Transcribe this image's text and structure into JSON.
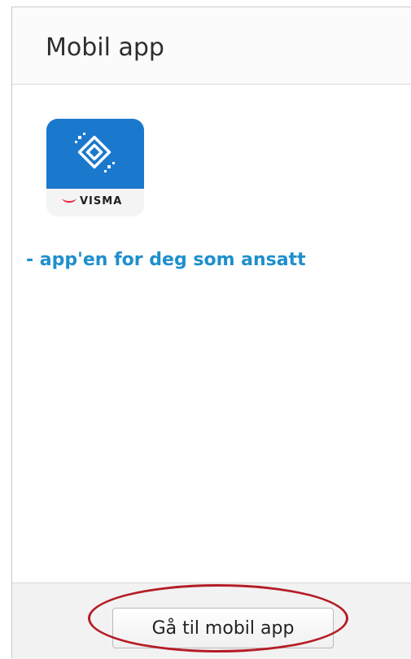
{
  "panel": {
    "title": "Mobil app",
    "tagline": "- app'en for deg som ansatt"
  },
  "app_icon": {
    "brand_text": "VISMA",
    "icon_name": "visma-mobile-app-icon",
    "colors": {
      "top_background": "#1a78cd",
      "bottom_background": "#f4f4f4",
      "brand_mark": "#e52b41"
    }
  },
  "footer": {
    "button_label": "Gå til mobil app"
  },
  "annotation": {
    "highlight_color": "#b51d26"
  }
}
